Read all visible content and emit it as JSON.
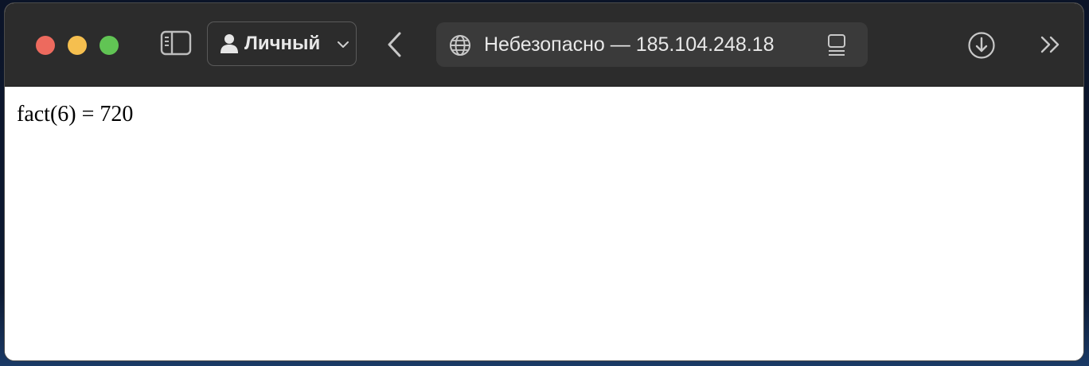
{
  "toolbar": {
    "profile_label": "Личный",
    "address": "Небезопасно — 185.104.248.18",
    "icons": {
      "sidebar": "sidebar-icon",
      "profile": "person-icon",
      "chevron": "chevron-down-icon",
      "back": "chevron-left-icon",
      "globe": "globe-icon",
      "reader": "reader-icon",
      "download": "download-icon",
      "more": "double-chevron-right-icon"
    }
  },
  "page": {
    "text": "fact(6) = 720"
  },
  "colors": {
    "close": "#ed6a5e",
    "minimize": "#f5bf4f",
    "zoom": "#61c454",
    "toolbar_bg": "#2c2c2c",
    "urlbar_bg": "#3a3a3a"
  }
}
